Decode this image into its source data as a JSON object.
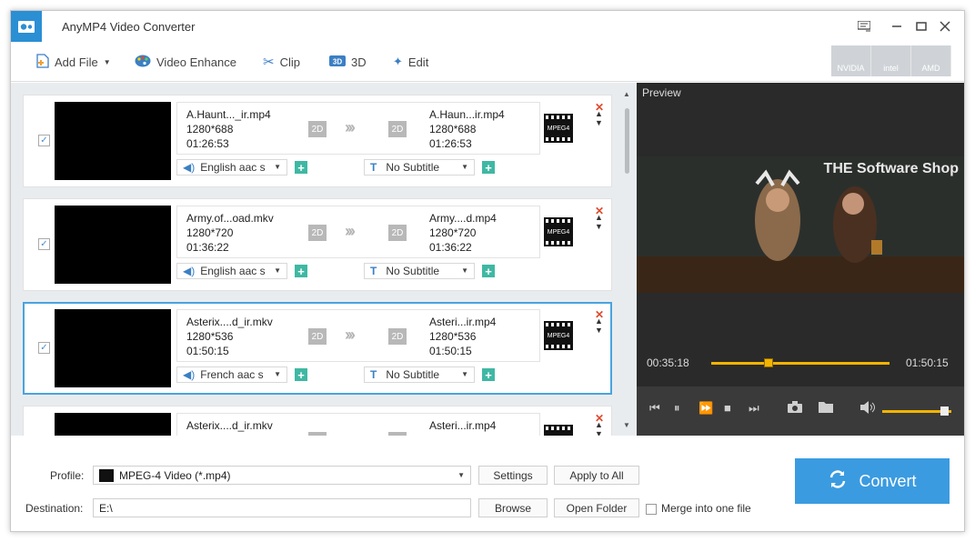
{
  "app": {
    "title": "AnyMP4 Video Converter"
  },
  "toolbar": {
    "add_file": "Add File",
    "video_enhance": "Video Enhance",
    "clip": "Clip",
    "three_d": "3D",
    "edit": "Edit",
    "gpu": [
      "NVIDIA",
      "intel",
      "AMD"
    ]
  },
  "files": [
    {
      "src_name": "A.Haunt..._ir.mp4",
      "src_res": "1280*688",
      "src_dur": "01:26:53",
      "dst_name": "A.Haun...ir.mp4",
      "dst_res": "1280*688",
      "dst_dur": "01:26:53",
      "audio": "English aac s",
      "subtitle": "No Subtitle",
      "checked": true
    },
    {
      "src_name": "Army.of...oad.mkv",
      "src_res": "1280*720",
      "src_dur": "01:36:22",
      "dst_name": "Army....d.mp4",
      "dst_res": "1280*720",
      "dst_dur": "01:36:22",
      "audio": "English aac s",
      "subtitle": "No Subtitle",
      "checked": true
    },
    {
      "src_name": "Asterix....d_ir.mkv",
      "src_res": "1280*536",
      "src_dur": "01:50:15",
      "dst_name": "Asteri...ir.mp4",
      "dst_res": "1280*536",
      "dst_dur": "01:50:15",
      "audio": "French aac s",
      "subtitle": "No Subtitle",
      "checked": true
    },
    {
      "src_name": "Asterix....d_ir.mkv",
      "src_res": "",
      "src_dur": "",
      "dst_name": "Asteri...ir.mp4",
      "dst_res": "",
      "dst_dur": "",
      "audio": "",
      "subtitle": "",
      "checked": false
    }
  ],
  "badge_2d": "2D",
  "format_icon_label": "MPEG4",
  "preview": {
    "title": "Preview",
    "watermark": "THE Software Shop",
    "current_time": "00:35:18",
    "total_time": "01:50:15",
    "progress": 0.32,
    "volume": 0.9
  },
  "bottom": {
    "profile_label": "Profile:",
    "profile_value": "MPEG-4 Video (*.mp4)",
    "settings": "Settings",
    "apply_all": "Apply to All",
    "destination_label": "Destination:",
    "destination_value": "E:\\",
    "browse": "Browse",
    "open_folder": "Open Folder",
    "merge": "Merge into one file",
    "convert": "Convert"
  },
  "colors": {
    "accent": "#3b9be0",
    "seek": "#f5b400",
    "plus": "#3fb8a3",
    "delete": "#e04a2c"
  }
}
